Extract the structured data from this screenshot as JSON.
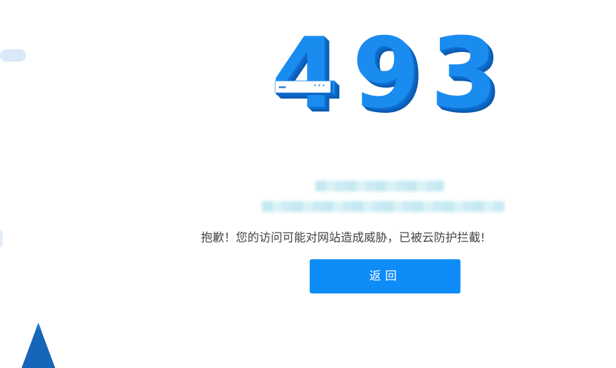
{
  "error": {
    "code_digits": [
      "4",
      "9",
      "3"
    ],
    "message": "抱歉！您的访问可能对网站造成威胁，已被云防护拦截!",
    "back_button_label": "返回"
  },
  "decor": {
    "window_bar_dots": "•••"
  },
  "colors": {
    "digit": "#1a8cf0",
    "digit_shadow": "#0d66c4",
    "button": "#0e8cf8",
    "moon": "#c9dff6",
    "mountain": "#1565b8"
  }
}
